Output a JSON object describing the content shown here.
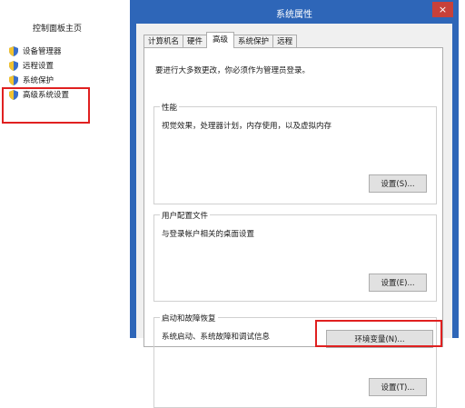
{
  "left_panel": {
    "title": "控制面板主页",
    "items": [
      {
        "label": "设备管理器",
        "icon": "shield-icon"
      },
      {
        "label": "远程设置",
        "icon": "shield-icon"
      },
      {
        "label": "系统保护",
        "icon": "shield-icon"
      },
      {
        "label": "高级系统设置",
        "icon": "shield-icon"
      }
    ]
  },
  "dialog": {
    "title": "系统属性",
    "close_glyph": "×",
    "tabs": [
      "计算机名",
      "硬件",
      "高级",
      "系统保护",
      "远程"
    ],
    "active_tab": "高级",
    "intro": "要进行大多数更改，你必须作为管理员登录。",
    "groups": [
      {
        "label": "性能",
        "desc": "视觉效果，处理器计划，内存使用，以及虚拟内存",
        "button": "设置(S)..."
      },
      {
        "label": "用户配置文件",
        "desc": "与登录帐户相关的桌面设置",
        "button": "设置(E)..."
      },
      {
        "label": "启动和故障恢复",
        "desc": "系统启动、系统故障和调试信息",
        "button": "设置(T)..."
      }
    ],
    "env_button": "环境变量(N)..."
  },
  "colors": {
    "titlebar": "#2e66b8",
    "close": "#c7413a",
    "highlight": "#e02020"
  }
}
